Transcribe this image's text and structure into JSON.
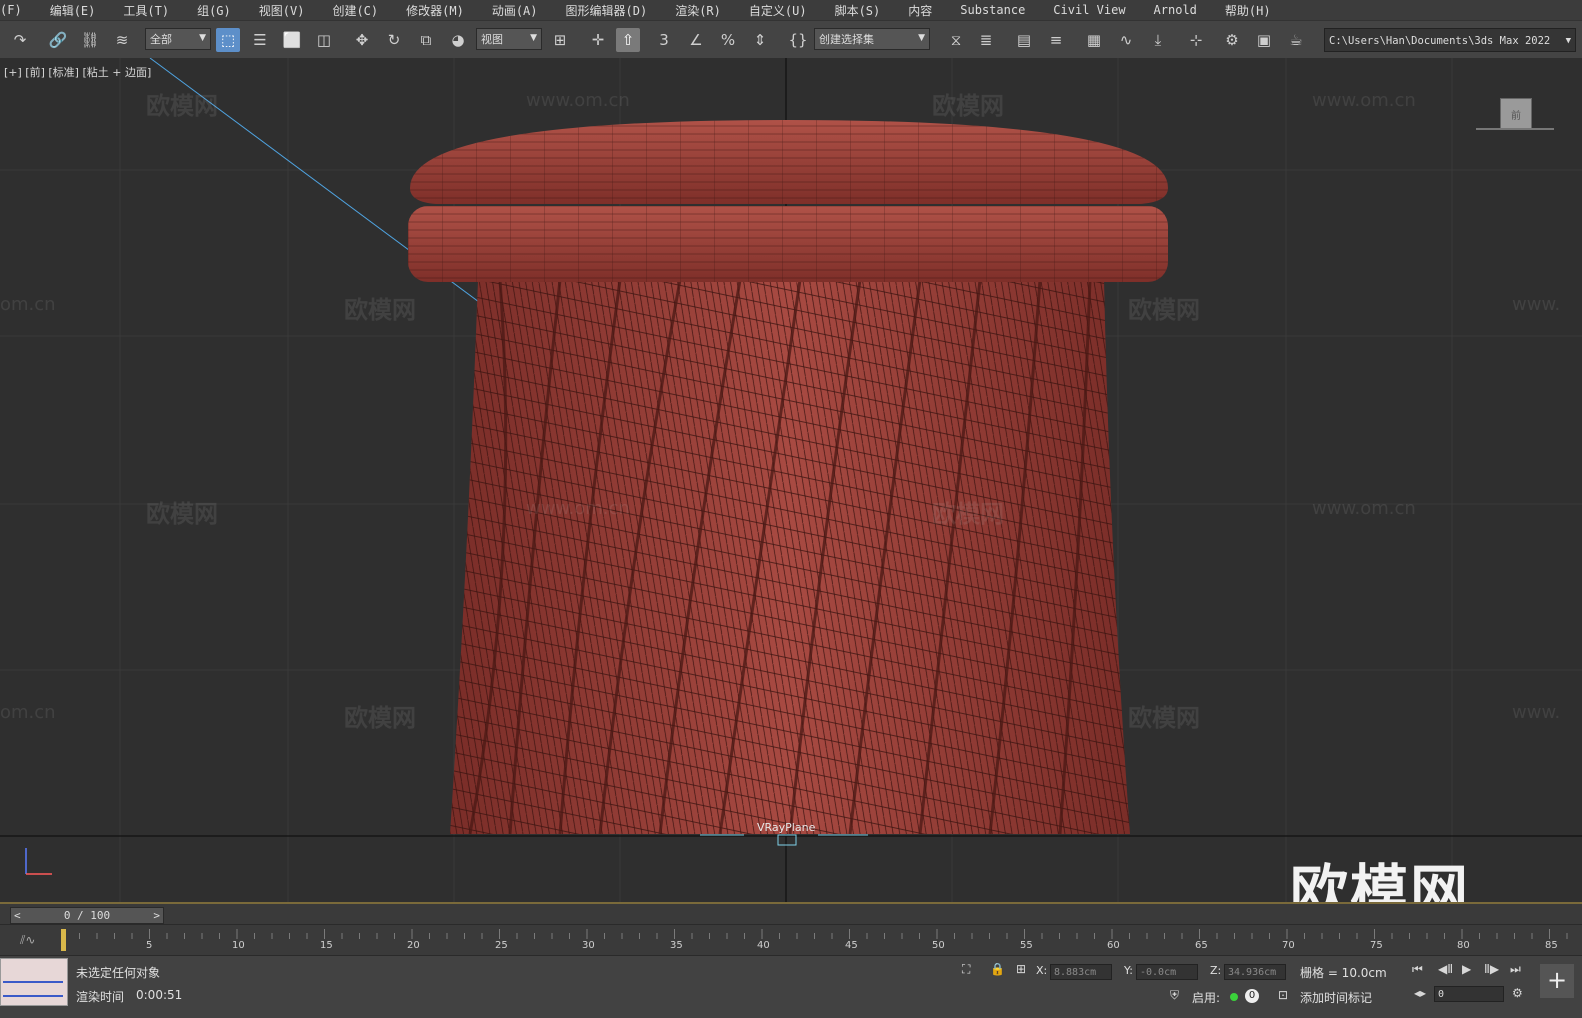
{
  "menu": [
    "(F)",
    "编辑(E)",
    "工具(T)",
    "组(G)",
    "视图(V)",
    "创建(C)",
    "修改器(M)",
    "动画(A)",
    "图形编辑器(D)",
    "渲染(R)",
    "自定义(U)",
    "脚本(S)",
    "内容",
    "Substance",
    "Civil View",
    "Arnold",
    "帮助(H)"
  ],
  "toolbar": {
    "selection_filter": "全部",
    "ref_coord": "视图",
    "named_selection": "创建选择集",
    "project_path": "C:\\Users\\Han\\Documents\\3ds Max 2022"
  },
  "viewport": {
    "label": "[+] [前] [标准] [粘土 + 边面]",
    "object_label": "VRayPlane",
    "viewcube_label": "前",
    "watermark_text": "欧模网",
    "watermark_url": "www.om.cn",
    "watermark_url_partial": "om.cn",
    "watermark_url_cut": "www.",
    "brand_logo": "欧模网"
  },
  "timeline": {
    "frame_display": "0 / 100",
    "prev": "<",
    "next": ">",
    "ticks": [
      "5",
      "10",
      "15",
      "20",
      "25",
      "30",
      "35",
      "40",
      "45",
      "50",
      "55",
      "60",
      "65",
      "70",
      "75",
      "80",
      "85"
    ]
  },
  "status": {
    "selection": "未选定任何对象",
    "render_time_label": "渲染时间",
    "render_time": "0:00:51",
    "x_label": "X:",
    "x_value": "8.883cm",
    "y_label": "Y:",
    "y_value": "-0.0cm",
    "z_label": "Z:",
    "z_value": "34.936cm",
    "grid": "栅格 = 10.0cm",
    "enable_label": "启用:",
    "enable_count": "0",
    "add_time_tag": "添加时间标记",
    "frame_field": "0"
  },
  "colors": {
    "model": "#9c4038",
    "viewport_bg": "#2f2f2f",
    "accent": "#5d8fc9"
  }
}
